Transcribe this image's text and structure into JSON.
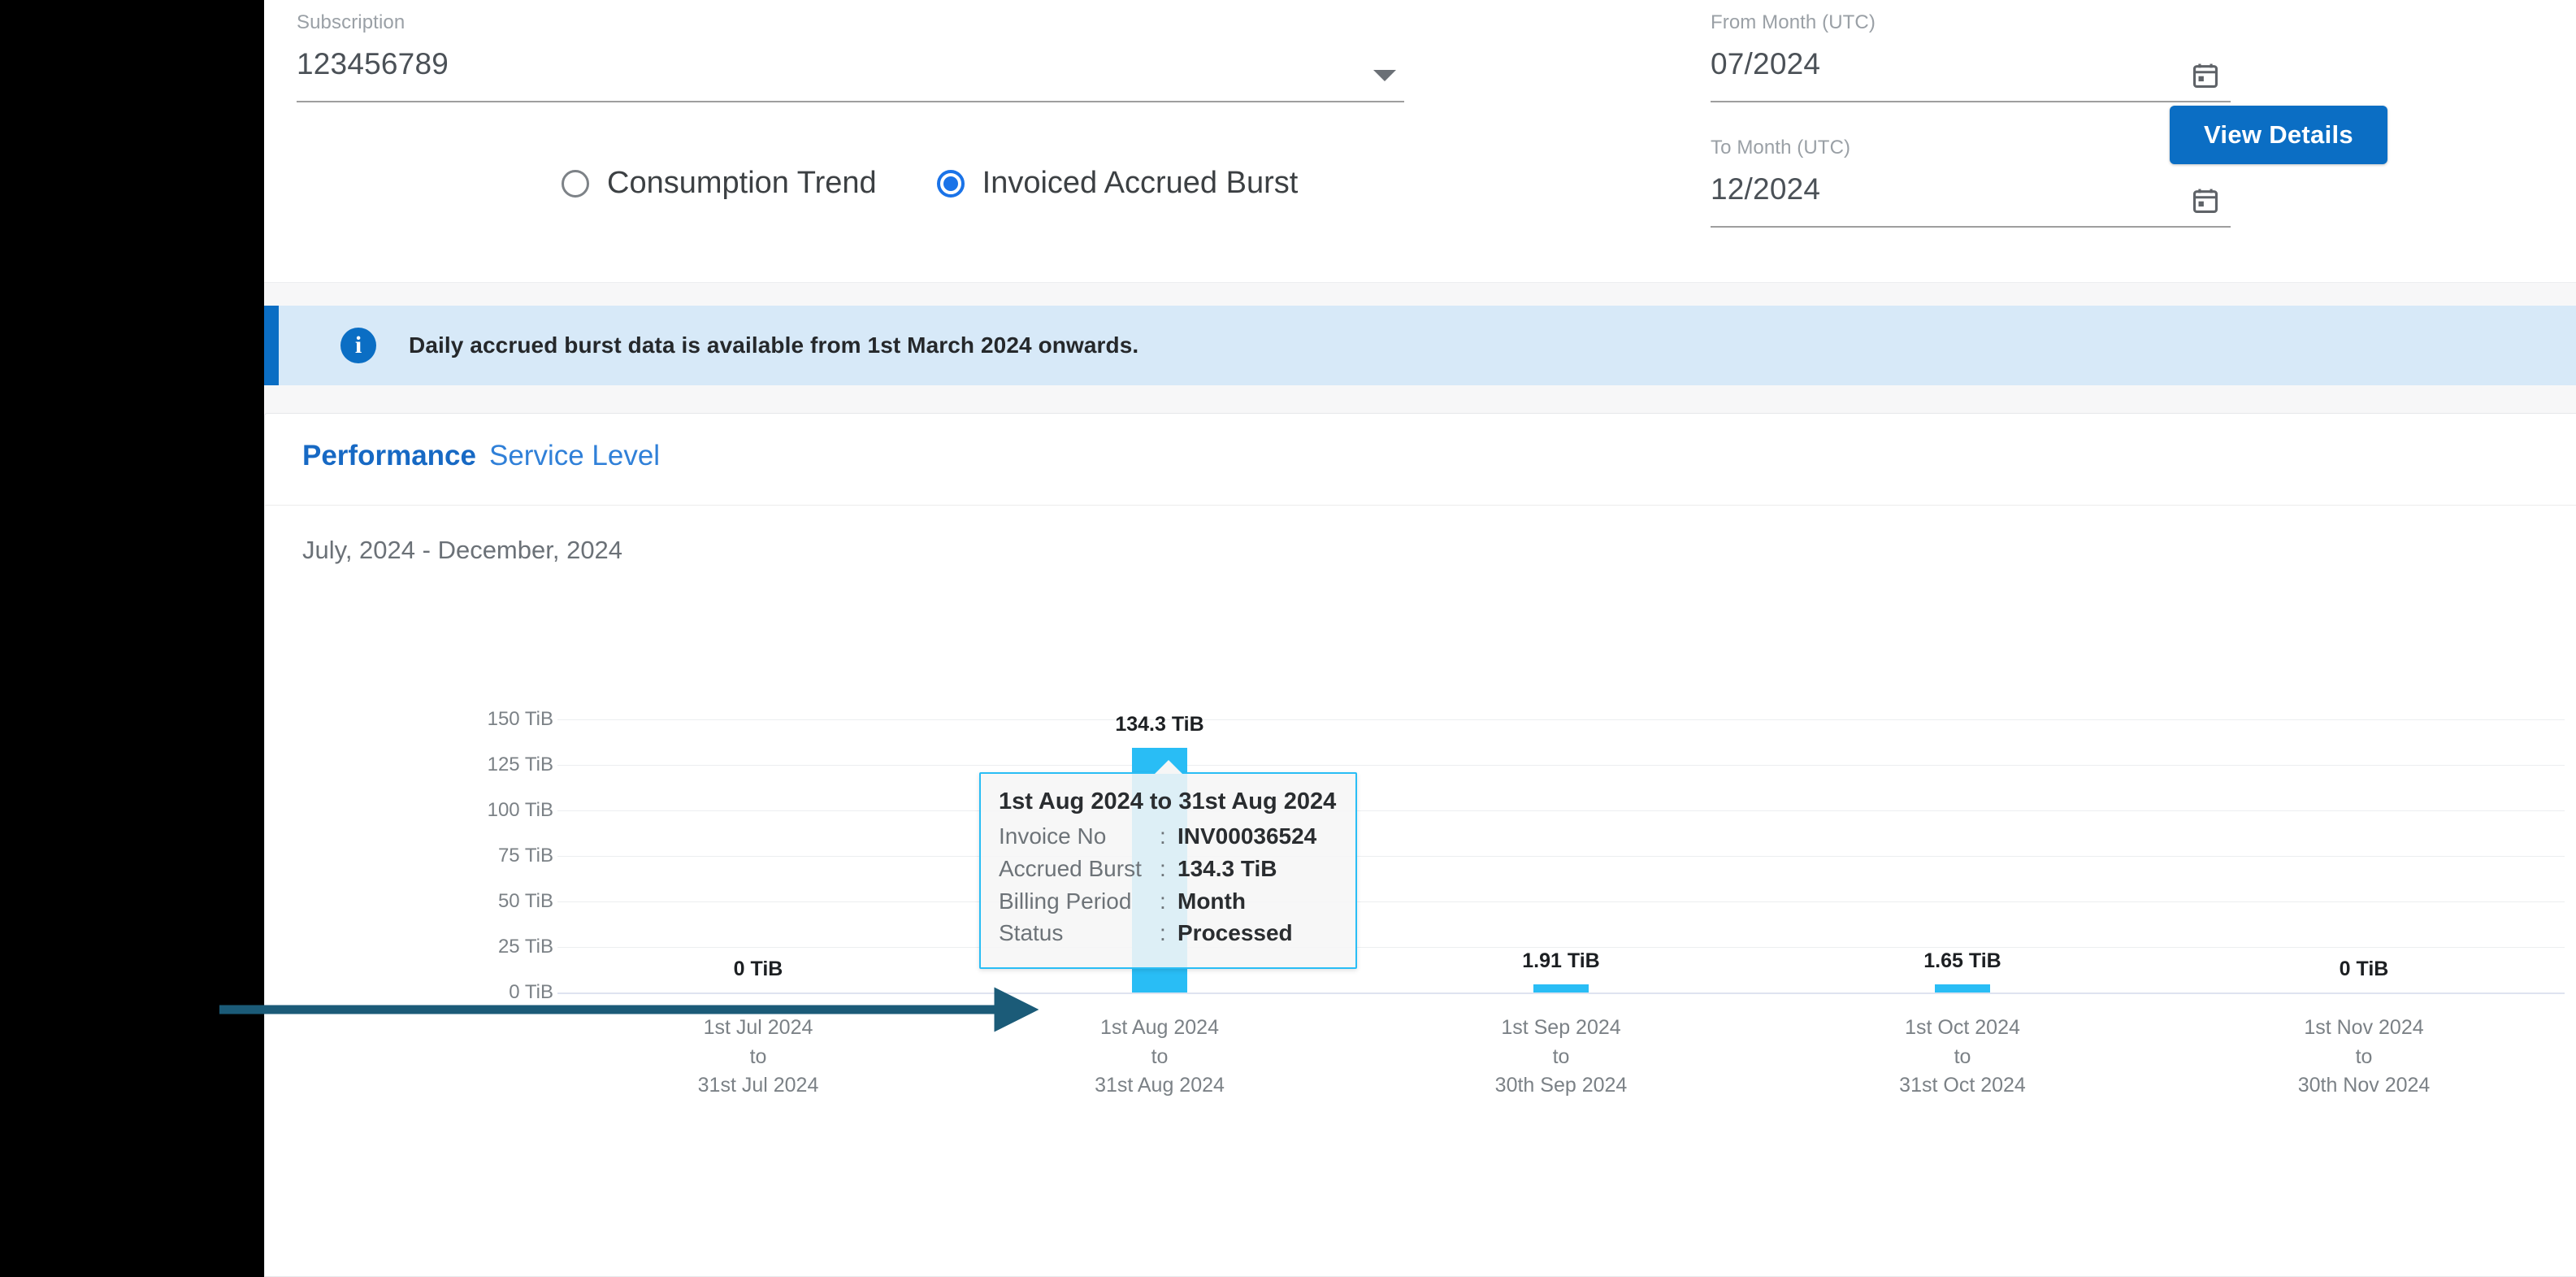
{
  "filters": {
    "subscription": {
      "label": "Subscription",
      "value": "123456789",
      "caret_icon": "chevron-down-icon"
    },
    "from_month": {
      "label": "From Month (UTC)",
      "value": "07/2024",
      "icon": "calendar-icon"
    },
    "to_month": {
      "label": "To Month (UTC)",
      "value": "12/2024",
      "icon": "calendar-icon"
    },
    "view_mode": {
      "options": [
        {
          "label": "Consumption Trend",
          "selected": false
        },
        {
          "label": "Invoiced Accrued Burst",
          "selected": true
        }
      ]
    },
    "view_details_label": "View Details"
  },
  "banner": {
    "icon": "info-icon",
    "glyph": "i",
    "text": "Daily accrued burst data is available from 1st March 2024 onwards.",
    "accent_color": "#0b6ec4",
    "background_color": "#d7e9f8"
  },
  "card": {
    "tabs": [
      {
        "label": "Performance",
        "active": true
      },
      {
        "label": "Service Level",
        "active": false
      }
    ],
    "subtitle": "July, 2024 - December, 2024"
  },
  "tooltip": {
    "title": "1st Aug 2024 to 31st Aug 2024",
    "rows": [
      {
        "key": "Invoice No",
        "sep": ":",
        "value": "INV00036524"
      },
      {
        "key": "Accrued Burst",
        "sep": ":",
        "value": "134.3 TiB"
      },
      {
        "key": "Billing Period",
        "sep": ":",
        "value": "Month"
      },
      {
        "key": "Status",
        "sep": ":",
        "value": "Processed"
      }
    ],
    "border_color": "#29bdf5"
  },
  "chart_data": {
    "type": "bar",
    "title": "July, 2024 - December, 2024",
    "xlabel": "",
    "ylabel": "",
    "unit": "TiB",
    "ylim": [
      0,
      150
    ],
    "yticks": [
      0,
      25,
      50,
      75,
      100,
      125,
      150
    ],
    "ytick_labels": [
      "0 TiB",
      "25 TiB",
      "50 TiB",
      "75 TiB",
      "100 TiB",
      "125 TiB",
      "150 TiB"
    ],
    "grid": true,
    "legend": "none",
    "bar_color": "#29bdf5",
    "categories": [
      "1st Jul 2024\nto\n31st Jul 2024",
      "1st Aug 2024\nto\n31st Aug 2024",
      "1st Sep 2024\nto\n30th Sep 2024",
      "1st Oct 2024\nto\n31st Oct 2024",
      "1st Nov 2024\nto\n30th Nov 2024"
    ],
    "category_lines": [
      [
        "1st Jul 2024",
        "to",
        "31st Jul 2024"
      ],
      [
        "1st Aug 2024",
        "to",
        "31st Aug 2024"
      ],
      [
        "1st Sep 2024",
        "to",
        "30th Sep 2024"
      ],
      [
        "1st Oct 2024",
        "to",
        "31st Oct 2024"
      ],
      [
        "1st Nov 2024",
        "to",
        "30th Nov 2024"
      ]
    ],
    "values": [
      0,
      134.3,
      1.91,
      1.65,
      0
    ],
    "value_labels": [
      "0 TiB",
      "134.3 TiB",
      "1.91 TiB",
      "1.65 TiB",
      "0 TiB"
    ]
  },
  "annotation": {
    "type": "arrow",
    "color": "#1b5b78",
    "points_to": "1st Aug 2024 bar"
  }
}
